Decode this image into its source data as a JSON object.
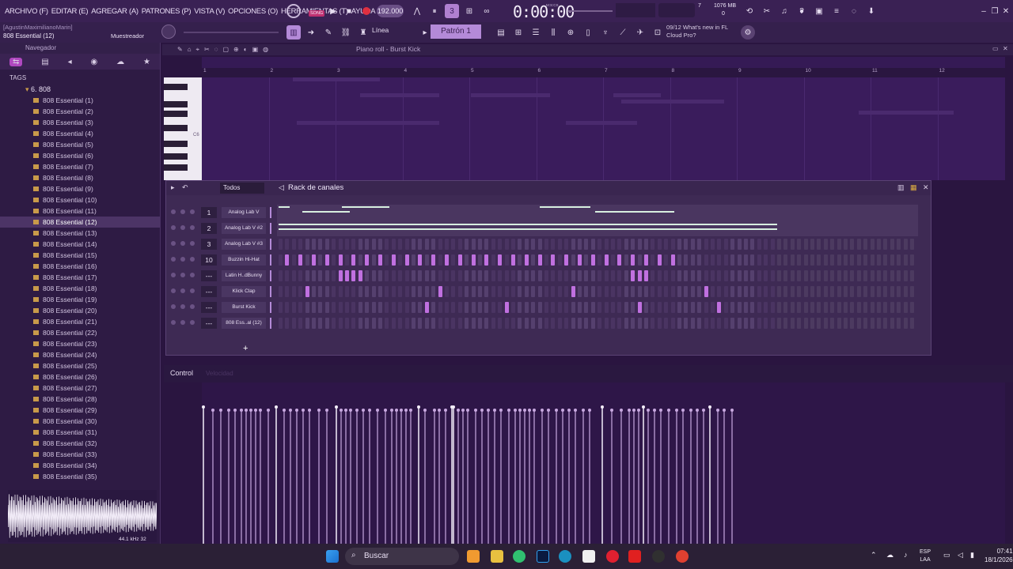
{
  "menu": [
    "ARCHIVO (F)",
    "EDITAR (E)",
    "AGREGAR (A)",
    "PATRONES (P)",
    "VISTA (V)",
    "OPCIONES (O)",
    "HERRAMIENTAS (T)",
    "AYUDA"
  ],
  "transport": {
    "tempo": "192.000",
    "time": "0:00:00",
    "time_unit": "M:S:CS",
    "song_label": "SONG",
    "cpu_value": "7",
    "memory": "1076 MB",
    "polyphony": "0"
  },
  "hint": {
    "user": "[AgustinMaximilianoMarin]",
    "sample": "808 Essential (12)",
    "mode": "Muestreador"
  },
  "snap": "Línea",
  "pattern": "Patrón 1",
  "news": {
    "date": "09/12",
    "line1": "What's new in FL",
    "line2": "Cloud Pro?"
  },
  "browser": {
    "title": "Navegador",
    "tags_label": "TAGS",
    "folder": "6. 808",
    "selected_index": 11,
    "files": [
      "808 Essential (1)",
      "808 Essential (2)",
      "808 Essential (3)",
      "808 Essential (4)",
      "808 Essential (5)",
      "808 Essential (6)",
      "808 Essential (7)",
      "808 Essential (8)",
      "808 Essential (9)",
      "808 Essential (10)",
      "808 Essential (11)",
      "808 Essential (12)",
      "808 Essential (13)",
      "808 Essential (14)",
      "808 Essential (15)",
      "808 Essential (16)",
      "808 Essential (17)",
      "808 Essential (18)",
      "808 Essential (19)",
      "808 Essential (20)",
      "808 Essential (21)",
      "808 Essential (22)",
      "808 Essential (23)",
      "808 Essential (24)",
      "808 Essential (25)",
      "808 Essential (26)",
      "808 Essential (27)",
      "808 Essential (28)",
      "808 Essential (29)",
      "808 Essential (30)",
      "808 Essential (31)",
      "808 Essential (32)",
      "808 Essential (33)",
      "808 Essential (34)",
      "808 Essential (35)"
    ],
    "sample_info": "44.1 kHz 32"
  },
  "piano_roll": {
    "title": "Piano roll - Burst Kick",
    "ruler": [
      "1",
      "2",
      "3",
      "4",
      "5",
      "6",
      "7",
      "8",
      "9",
      "10",
      "11",
      "12"
    ],
    "key_label": "C6"
  },
  "rack": {
    "title": "Rack de canales",
    "filter": "Todos",
    "channels": [
      {
        "num": "1",
        "name": "Analog Lab V",
        "type": "roll"
      },
      {
        "num": "2",
        "name": "Analog Lab V #2",
        "type": "roll"
      },
      {
        "num": "3",
        "name": "Analog Lab V #3",
        "type": "steps",
        "on": []
      },
      {
        "num": "10",
        "name": "Buzzin Hi-Hat",
        "type": "steps",
        "on": [
          1,
          3,
          5,
          7,
          9,
          11,
          13,
          15,
          17,
          19,
          21,
          23,
          25,
          27,
          29,
          31,
          33,
          35,
          37,
          39,
          41,
          43,
          45,
          47,
          49,
          51,
          53,
          55,
          57,
          59
        ]
      },
      {
        "num": "---",
        "name": "Latin H..dBunny",
        "type": "steps",
        "on": [
          9,
          10,
          11,
          12,
          53,
          54,
          55
        ]
      },
      {
        "num": "---",
        "name": "Klick Clap",
        "type": "steps",
        "on": [
          4,
          24,
          44,
          64
        ]
      },
      {
        "num": "---",
        "name": "Burst Kick",
        "type": "steps",
        "on": [
          22,
          34,
          54,
          66
        ]
      },
      {
        "num": "---",
        "name": "808 Ess..al (12)",
        "type": "steps",
        "on": []
      }
    ]
  },
  "control": {
    "label": "Control",
    "param": "Velocidad"
  },
  "taskbar": {
    "search": "Buscar",
    "lang1": "ESP",
    "lang2": "LAA",
    "time": "07:41",
    "date": "18/1/2026"
  },
  "colors": {
    "accent": "#b48ad8",
    "step_on": "#c070e0",
    "step_off": "#4a3462",
    "grid": "#3a1c5c"
  }
}
